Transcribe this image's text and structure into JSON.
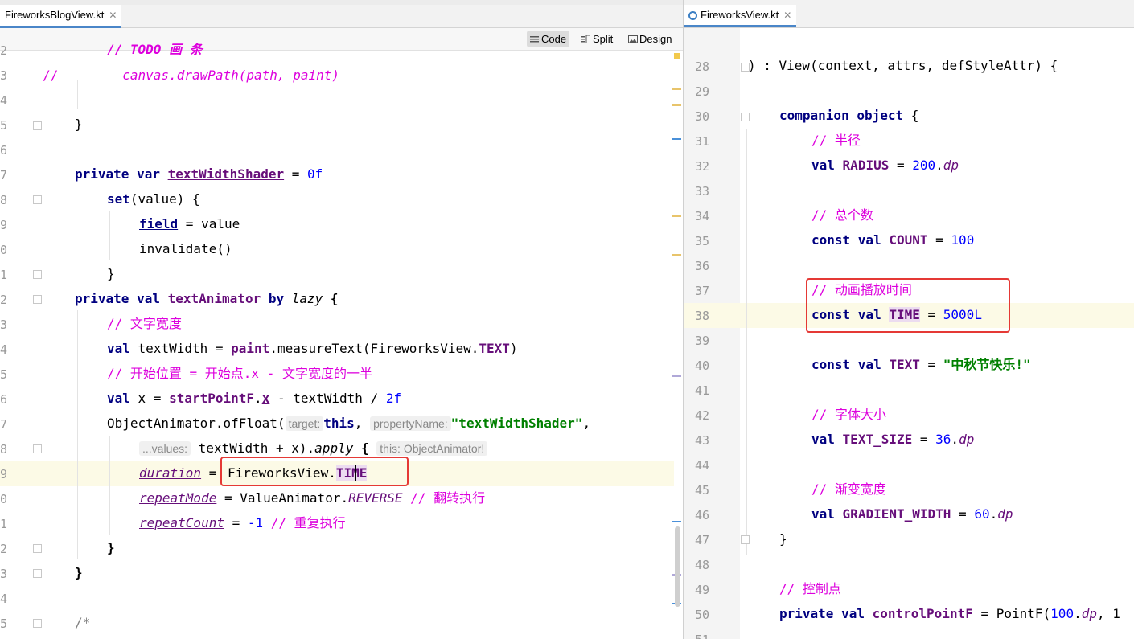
{
  "left_pane": {
    "tab": {
      "label": "FireworksBlogView.kt"
    },
    "view_modes": {
      "code": "Code",
      "split": "Split",
      "design": "Design"
    },
    "line_numbers": [
      "2",
      "3",
      "4",
      "5",
      "6",
      "7",
      "8",
      "9",
      "0",
      "1",
      "2",
      "3",
      "4",
      "5",
      "6",
      "7",
      "8",
      "9",
      "0",
      "1",
      "2",
      "3",
      "4",
      "5"
    ],
    "code": {
      "l0": "// TODO 画 条",
      "l1_comment": "//",
      "l1_code": "canvas.drawPath(path, paint)",
      "l3": "}",
      "l5_kw": "private var",
      "l5_prop": "textWidthShader",
      "l5_eq": " = ",
      "l5_num": "0f",
      "l6_kw": "set",
      "l6_rest": "(value) {",
      "l7_field": "field",
      "l7_rest": " = value",
      "l8": "invalidate()",
      "l9": "}",
      "l10_kw1": "private val",
      "l10_prop": "textAnimator",
      "l10_by": "by",
      "l10_lazy": "lazy",
      "l10_brace": "{",
      "l11": "// 文字宽度",
      "l12_kw": "val",
      "l12_mid": " textWidth = ",
      "l12_paint": "paint",
      "l12_call": ".measureText(FireworksView.",
      "l12_const": "TEXT",
      "l12_end": ")",
      "l13": "// 开始位置 = 开始点.x - 文字宽度的一半",
      "l14_kw": "val",
      "l14_mid": " x = ",
      "l14_prop": "startPointF",
      "l14_dot": ".",
      "l14_x": "x",
      "l14_op": " - textWidth / ",
      "l14_num": "2f",
      "l15_call": "ObjectAnimator.ofFloat(",
      "l15_hint1": "target:",
      "l15_this": "this",
      "l15_comma": ",",
      "l15_hint2": "propertyName:",
      "l15_str": "\"textWidthShader\"",
      "l15_end": ",",
      "l16_hint": "...values:",
      "l16_code": "textWidth + x).",
      "l16_apply": "apply",
      "l16_brace": "{",
      "l16_hint2": "this: ObjectAnimator!",
      "l17_prop": "duration",
      "l17_eq": " = ",
      "l17_obj": "FireworksView.",
      "l17_time": "TIME",
      "l18_prop": "repeatMode",
      "l18_mid": " = ValueAnimator.",
      "l18_const": "REVERSE",
      "l18_comment": "// 翻转执行",
      "l19_prop": "repeatCount",
      "l19_mid": " = ",
      "l19_num": "-1",
      "l19_comment": "// 重复执行",
      "l20": "}",
      "l21": "}",
      "l23": "/*"
    }
  },
  "right_pane": {
    "tab": {
      "label": "FireworksView.kt"
    },
    "line_numbers": [
      "28",
      "29",
      "30",
      "31",
      "32",
      "33",
      "34",
      "35",
      "36",
      "37",
      "38",
      "39",
      "40",
      "41",
      "42",
      "43",
      "44",
      "45",
      "46",
      "47",
      "48",
      "49",
      "50",
      "51"
    ],
    "code": {
      "r28": ") : View(context, attrs, defStyleAttr) {",
      "r30_kw": "companion object",
      "r30_brace": " {",
      "r31": "// 半径",
      "r32_kw": "val",
      "r32_name": "RADIUS",
      "r32_eq": " = ",
      "r32_num": "200",
      "r32_dot": ".",
      "r32_unit": "dp",
      "r34": "// 总个数",
      "r35_kw": "const val",
      "r35_name": "COUNT",
      "r35_eq": " = ",
      "r35_num": "100",
      "r37": "// 动画播放时间",
      "r38_kw": "const val",
      "r38_name": "TIME",
      "r38_eq": " = ",
      "r38_num": "5000L",
      "r40_kw": "const val",
      "r40_name": "TEXT",
      "r40_eq": " = ",
      "r40_str": "\"中秋节快乐!\"",
      "r42": "// 字体大小",
      "r43_kw": "val",
      "r43_name": "TEXT_SIZE",
      "r43_eq": " = ",
      "r43_num": "36",
      "r43_dot": ".",
      "r43_unit": "dp",
      "r45": "// 渐变宽度",
      "r46_kw": "val",
      "r46_name": "GRADIENT_WIDTH",
      "r46_eq": " = ",
      "r46_num": "60",
      "r46_dot": ".",
      "r46_unit": "dp",
      "r47": "}",
      "r49": "// 控制点",
      "r50_kw": "private val",
      "r50_name": "controlPointF",
      "r50_mid": " = PointF(",
      "r50_num": "100",
      "r50_dot": ".",
      "r50_unit": "dp",
      "r50_end": ", 1"
    }
  },
  "colors": {
    "keyword": "#000080",
    "number": "#0000ff",
    "comment": "#dd00dd",
    "property": "#660e7a",
    "string": "#008000",
    "highlight_box": "#e53935",
    "current_line": "#fcfae6"
  }
}
